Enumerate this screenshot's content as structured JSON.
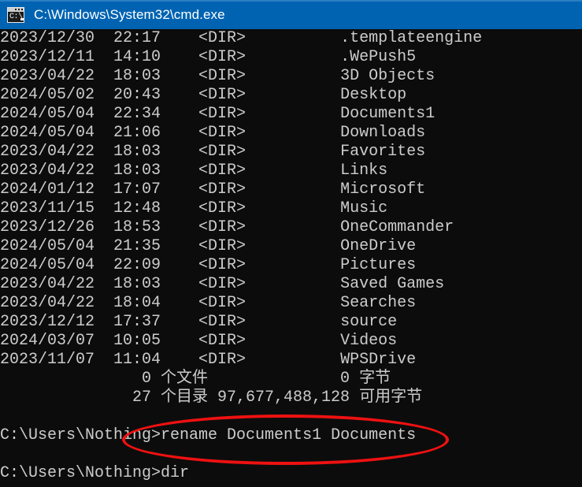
{
  "titlebar": {
    "icon": "cmd-console-icon",
    "icon_prompt_text": "C:\\",
    "title": "C:\\Windows\\System32\\cmd.exe",
    "background_color": "#0063B1",
    "text_color": "#FFFFFF"
  },
  "console": {
    "background_color": "#0C0C0C",
    "text_color": "#CCCCCC",
    "font_size_px": 20,
    "line_height_px": 24,
    "lines": [
      "2023/12/30  22:17    <DIR>          .templateengine",
      "2023/12/11  14:10    <DIR>          .WePush5",
      "2023/04/22  18:03    <DIR>          3D Objects",
      "2024/05/02  20:43    <DIR>          Desktop",
      "2024/05/04  22:34    <DIR>          Documents1",
      "2024/05/04  21:06    <DIR>          Downloads",
      "2023/04/22  18:03    <DIR>          Favorites",
      "2023/04/22  18:03    <DIR>          Links",
      "2024/01/12  17:07    <DIR>          Microsoft",
      "2023/11/15  12:48    <DIR>          Music",
      "2023/12/26  18:53    <DIR>          OneCommander",
      "2024/05/04  21:35    <DIR>          OneDrive",
      "2024/05/04  22:09    <DIR>          Pictures",
      "2023/04/22  18:03    <DIR>          Saved Games",
      "2023/04/22  18:04    <DIR>          Searches",
      "2023/12/12  17:37    <DIR>          source",
      "2024/03/07  10:05    <DIR>          Videos",
      "2023/11/07  11:04    <DIR>          WPSDrive",
      "               0 个文件              0 字节",
      "              27 个目录 97,677,488,128 可用字节",
      "",
      "C:\\Users\\Nothing>rename Documents1 Documents",
      "",
      "C:\\Users\\Nothing>dir"
    ],
    "directory_listing": {
      "columns": [
        "date",
        "time",
        "type",
        "name"
      ],
      "rows": [
        {
          "date": "2023/12/30",
          "time": "22:17",
          "type": "<DIR>",
          "name": ".templateengine"
        },
        {
          "date": "2023/12/11",
          "time": "14:10",
          "type": "<DIR>",
          "name": ".WePush5"
        },
        {
          "date": "2023/04/22",
          "time": "18:03",
          "type": "<DIR>",
          "name": "3D Objects"
        },
        {
          "date": "2024/05/02",
          "time": "20:43",
          "type": "<DIR>",
          "name": "Desktop"
        },
        {
          "date": "2024/05/04",
          "time": "22:34",
          "type": "<DIR>",
          "name": "Documents1"
        },
        {
          "date": "2024/05/04",
          "time": "21:06",
          "type": "<DIR>",
          "name": "Downloads"
        },
        {
          "date": "2023/04/22",
          "time": "18:03",
          "type": "<DIR>",
          "name": "Favorites"
        },
        {
          "date": "2023/04/22",
          "time": "18:03",
          "type": "<DIR>",
          "name": "Links"
        },
        {
          "date": "2024/01/12",
          "time": "17:07",
          "type": "<DIR>",
          "name": "Microsoft"
        },
        {
          "date": "2023/11/15",
          "time": "12:48",
          "type": "<DIR>",
          "name": "Music"
        },
        {
          "date": "2023/12/26",
          "time": "18:53",
          "type": "<DIR>",
          "name": "OneCommander"
        },
        {
          "date": "2024/05/04",
          "time": "21:35",
          "type": "<DIR>",
          "name": "OneDrive"
        },
        {
          "date": "2024/05/04",
          "time": "22:09",
          "type": "<DIR>",
          "name": "Pictures"
        },
        {
          "date": "2023/04/22",
          "time": "18:03",
          "type": "<DIR>",
          "name": "Saved Games"
        },
        {
          "date": "2023/04/22",
          "time": "18:04",
          "type": "<DIR>",
          "name": "Searches"
        },
        {
          "date": "2023/12/12",
          "time": "17:37",
          "type": "<DIR>",
          "name": "source"
        },
        {
          "date": "2024/03/07",
          "time": "10:05",
          "type": "<DIR>",
          "name": "Videos"
        },
        {
          "date": "2023/11/07",
          "time": "11:04",
          "type": "<DIR>",
          "name": "WPSDrive"
        }
      ],
      "summary": {
        "file_count": "0",
        "file_count_label": "个文件",
        "total_bytes": "0",
        "total_bytes_label": "字节",
        "dir_count": "27",
        "dir_count_label": "个目录",
        "free_bytes": "97,677,488,128",
        "free_bytes_label": "可用字节"
      }
    },
    "prompt": "C:\\Users\\Nothing>",
    "commands": [
      {
        "prompt": "C:\\Users\\Nothing>",
        "command": "rename Documents1 Documents"
      },
      {
        "prompt": "C:\\Users\\Nothing>",
        "command": "dir"
      }
    ]
  },
  "annotation": {
    "shape": "ellipse",
    "color": "#EE1111",
    "stroke_px": 4,
    "target_text": "rename Documents1 Documents"
  }
}
